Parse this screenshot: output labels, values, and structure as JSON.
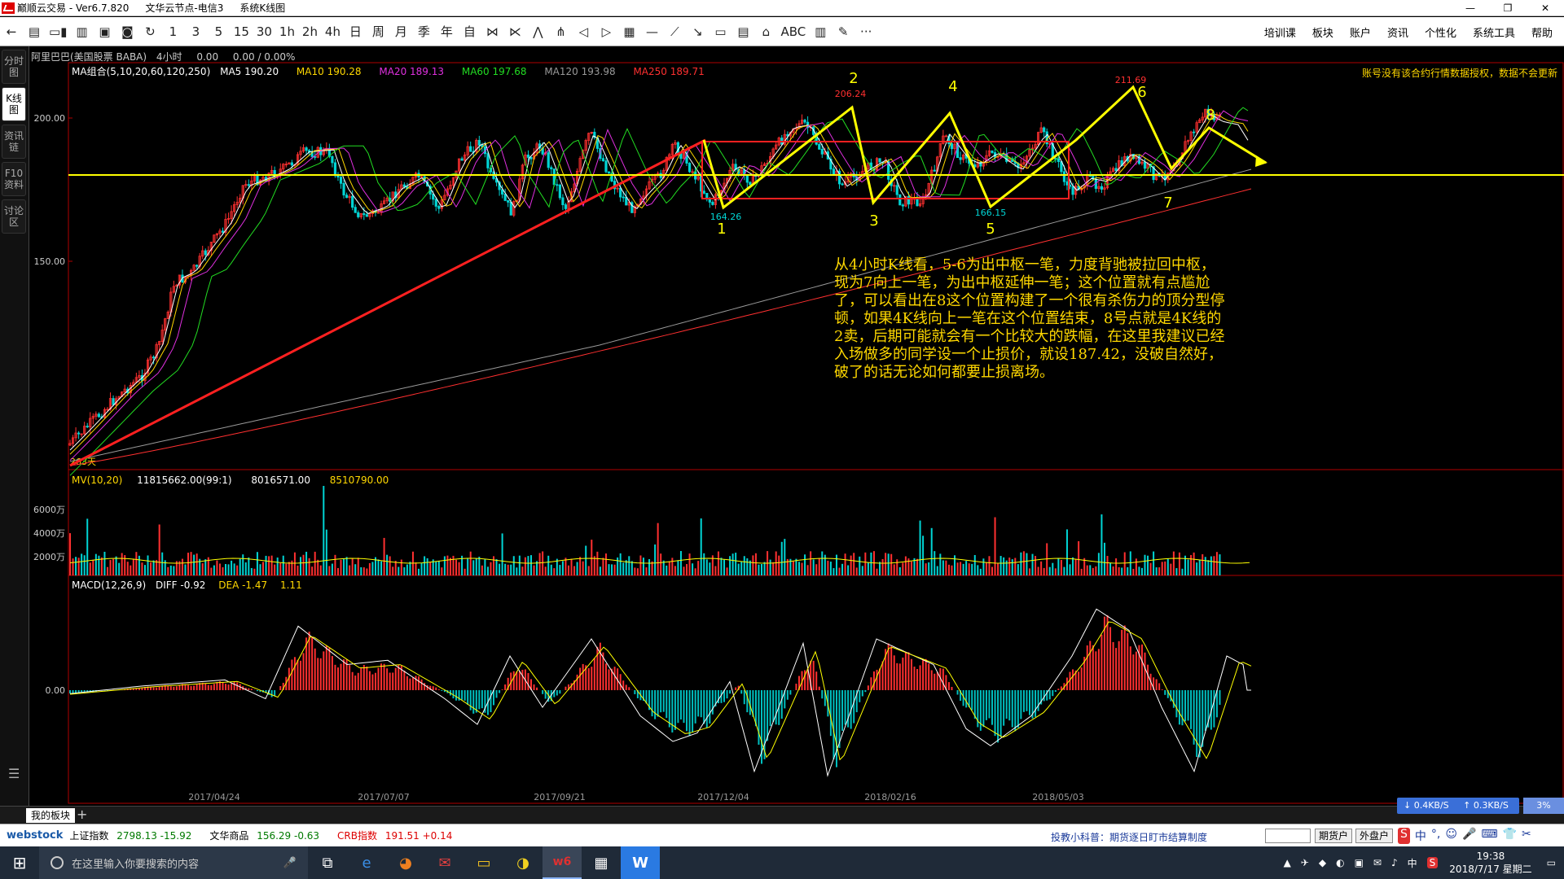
{
  "window": {
    "app_title": "巅顺云交易 - Ver6.7.820",
    "server": "文华云节点-电信3",
    "diagram": "系统K线图",
    "controls": [
      "—",
      "❐",
      "✕"
    ]
  },
  "toolbar": {
    "nav": [
      "←",
      "▤",
      "▭▮",
      "▥",
      "▣",
      "◙",
      "↻"
    ],
    "periods": [
      "1",
      "3",
      "5",
      "15",
      "30",
      "1h",
      "2h",
      "4h",
      "日",
      "周",
      "月",
      "季",
      "年",
      "自"
    ],
    "tools": [
      "⋈",
      "⋉",
      "⋀",
      "⋔",
      "◁",
      "▷",
      "▦",
      "—",
      "⟋",
      "↘",
      "▭",
      "▤",
      "⌂",
      "ABC",
      "▥",
      "✎",
      "···"
    ],
    "right_menu": [
      "培训课",
      "板块",
      "账户",
      "资讯",
      "个性化",
      "系统工具",
      "帮助"
    ]
  },
  "sidebar": {
    "tabs": [
      "分时图",
      "K线图",
      "资讯链",
      "F10资料",
      "讨论区"
    ],
    "active": "K线图",
    "menu_icon": "☰"
  },
  "chart_header": {
    "symbol": "阿里巴巴(美国股票 BABA)",
    "period": "4小时",
    "price": "0.00",
    "change": "0.00 / 0.00%",
    "ma_label": "MA组合(5,10,20,60,120,250)",
    "ma5": "MA5 190.20",
    "ma10": "MA10 190.28",
    "ma20": "MA20 189.13",
    "ma60": "MA60 197.68",
    "ma120": "MA120 193.98",
    "ma250": "MA250 189.71",
    "warning": "账号没有该合约行情数据授权，数据不会更新",
    "yaxis": [
      "200.00",
      "150.00"
    ],
    "start_label": "263天",
    "vol_label": "MV(10,20)",
    "vol_v1": "11815662.00(99:1)",
    "vol_v2": "8016571.00",
    "vol_v3": "8510790.00",
    "vol_yaxis": [
      "6000万",
      "4000万",
      "2000万"
    ],
    "macd_label": "MACD(12,26,9)",
    "diff": "DIFF -0.92",
    "dea": "DEA -1.47",
    "macd_val": "1.11",
    "macd_zero": "0.00",
    "dates": [
      "2017/04/24",
      "2017/07/07",
      "2017/09/21",
      "2017/12/04",
      "2018/02/16",
      "2018/05/03"
    ]
  },
  "annotations": {
    "points": [
      "1",
      "2",
      "3",
      "4",
      "5",
      "6",
      "7",
      "8"
    ],
    "prices": [
      "164.26",
      "206.24",
      "166.15",
      "211.69"
    ],
    "note_lines": [
      "从4小时K线看，5-6为出中枢一笔，力度背驰被拉回中枢，",
      "现为7向上一笔，为出中枢延伸一笔；这个位置就有点尴尬",
      "了，可以看出在8这个位置构建了一个很有杀伤力的顶分型停",
      "顿，如果4K线向上一笔在这个位置结束，8号点就是4K线的",
      "2卖，后期可能就会有一个比较大的跌幅，在这里我建议已经",
      "入场做多的同学设一个止损价，就设187.42，没破自然好，",
      "破了的话无论如何都要止损离场。"
    ]
  },
  "bottom": {
    "tab": "我的板块",
    "plus": "+",
    "net_down": "↓ 0.4KB/S",
    "net_up": "↑ 0.3KB/S",
    "net_pct": "3%"
  },
  "statusbar": {
    "logo": "webstock",
    "idx1_name": "上证指数",
    "idx1_val": "2798.13 -15.92",
    "idx2_name": "文华商品",
    "idx2_val": "156.29 -0.63",
    "idx3_name": "CRB指数",
    "idx3_val": "191.51 +0.14",
    "tip": "投教小科普：期货逐日盯市结算制度",
    "btn1": "期货户",
    "btn2": "外盘户",
    "ime": [
      "S",
      "中",
      "°,",
      "☺",
      "🎤",
      "⌨",
      "👕",
      "✂"
    ]
  },
  "taskbar": {
    "start": "⊞",
    "search_placeholder": "在这里输入你要搜索的内容",
    "mic": "🎤",
    "apps": [
      "⧉",
      "e",
      "◕",
      "✉",
      "▭",
      "◑",
      "w6",
      "▦",
      "W"
    ],
    "tray": [
      "▲",
      "✈",
      "◆",
      "◐",
      "▣",
      "✉",
      "♪",
      "中",
      "S"
    ],
    "time": "19:38",
    "date": "2018/7/17 星期二",
    "notify": "▭"
  }
}
